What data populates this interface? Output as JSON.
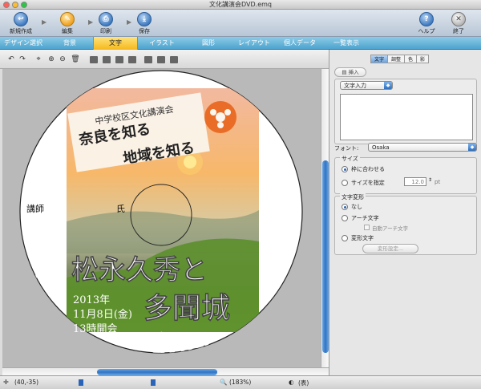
{
  "window": {
    "title": "文化講演会DVD.emq"
  },
  "toolbar": {
    "new_label": "新規作成",
    "edit_label": "編集",
    "print_label": "印刷",
    "save_label": "保存",
    "help_label": "ヘルプ",
    "quit_label": "終了"
  },
  "tabs": [
    {
      "label": "デザイン選択"
    },
    {
      "label": "背景"
    },
    {
      "label": "文字"
    },
    {
      "label": "イラスト"
    },
    {
      "label": "図形"
    },
    {
      "label": "レイアウト"
    },
    {
      "label": "個人データ"
    },
    {
      "label": "一覧表示"
    }
  ],
  "active_tab": "文字",
  "disc": {
    "header_line": "中学校区文化講演会",
    "title_line1": "奈良を知る",
    "title_line2": "地域を知る",
    "lecturer_label": "講師",
    "honorific": "氏",
    "speaker_name_line1": "松永久秀と",
    "speaker_name_line2": "多聞城",
    "date_year": "2013年",
    "date_day": "11月8日(金)",
    "time": "13時開会"
  },
  "panel": {
    "subtabs": [
      "文字",
      "調整",
      "色",
      "影"
    ],
    "insert_label": "挿入",
    "text_input_select": "文字入力",
    "font_label": "フォント:",
    "font_value": "Osaka",
    "size_group_label": "サイズ",
    "fit_to_frame_label": "枠に合わせる",
    "specify_size_label": "サイズを指定",
    "size_value": "12.0",
    "size_unit": "pt",
    "transform_group_label": "文字変形",
    "none_label": "なし",
    "arch_label": "アーチ文字",
    "auto_arch_label": "自動アーチ文字",
    "deform_label": "変形文字",
    "deform_settings_button": "変形設定..."
  },
  "status": {
    "coords": "(40,-35)",
    "zoom": "(183%)",
    "side": "(表)"
  },
  "colors": {
    "accent_blue": "#2f74c4",
    "tab_active": "#f5b71c",
    "tab_bar": "#4ea3cf"
  }
}
